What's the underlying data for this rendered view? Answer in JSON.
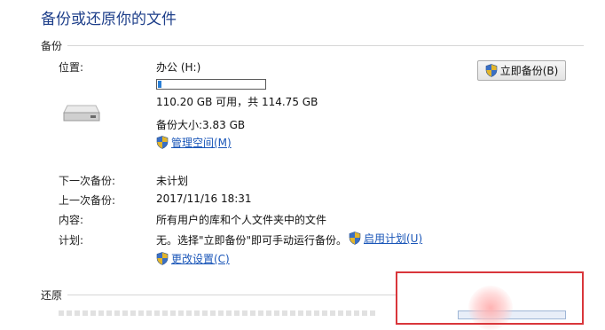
{
  "page": {
    "title": "备份或还原你的文件"
  },
  "backup_section": {
    "heading": "备份",
    "location_label": "位置:",
    "drive_name": "办公 (H:)",
    "disk_usage_fraction": 0.03,
    "space_text": "110.20 GB 可用，共 114.75 GB",
    "backup_size_text": "备份大小:3.83 GB",
    "manage_space_link": "管理空间(M)",
    "backup_now_button": "立即备份(B)",
    "next_backup_label": "下一次备份:",
    "next_backup_value": "未计划",
    "last_backup_label": "上一次备份:",
    "last_backup_value": "2017/11/16 18:31",
    "contents_label": "内容:",
    "contents_value": "所有用户的库和个人文件夹中的文件",
    "schedule_label": "计划:",
    "schedule_value": "无。选择\"立即备份\"即可手动运行备份。",
    "enable_schedule_link": "启用计划(U)",
    "change_settings_link": "更改设置(C)"
  },
  "restore_section": {
    "heading": "还原"
  },
  "colors": {
    "title": "#1e3f8a",
    "link": "#1a56b8",
    "progress": "#2a7fd6",
    "highlight_box": "#d9363b"
  },
  "icons": [
    "shield-icon",
    "drive-icon"
  ]
}
